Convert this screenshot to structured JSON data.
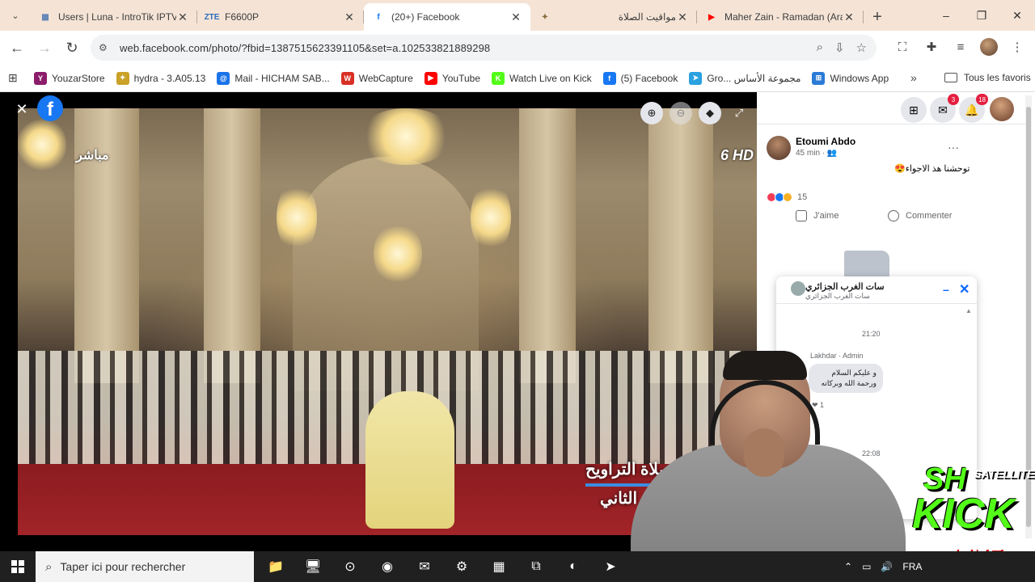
{
  "browser": {
    "tabs": [
      {
        "title": "Users | Luna - IntroTik IPTV",
        "icon_text": "▦",
        "icon_color": "#5a7fb5",
        "active": false,
        "rtl": false
      },
      {
        "title": "F6600P",
        "icon_text": "ZTE",
        "icon_color": "#2a6ebd",
        "active": false,
        "rtl": false
      },
      {
        "title": "(20+) Facebook",
        "icon_text": "f",
        "icon_color": "#1877f2",
        "active": true,
        "rtl": false
      },
      {
        "title": "مواقيت الصلاة",
        "icon_text": "✦",
        "icon_color": "#8a6d3b",
        "active": false,
        "rtl": true
      },
      {
        "title": "Maher Zain - Ramadan (Ara",
        "icon_text": "▶",
        "icon_color": "#ff0000",
        "active": false,
        "rtl": false
      }
    ],
    "new_tab": "+",
    "url": "web.facebook.com/photo/?fbid=1387515623391105&set=a.102533821889298",
    "bookmarks": [
      {
        "label": "YouzarStore",
        "icon_text": "Y",
        "icon_color": "#8b1d6b"
      },
      {
        "label": "hydra - 3.A05.13",
        "icon_text": "✦",
        "icon_color": "#c9a227"
      },
      {
        "label": "Mail - HICHAM SAB...",
        "icon_text": "@",
        "icon_color": "#1a73e8"
      },
      {
        "label": "WebCapture",
        "icon_text": "W",
        "icon_color": "#d93025"
      },
      {
        "label": "YouTube",
        "icon_text": "▶",
        "icon_color": "#ff0000"
      },
      {
        "label": "Watch Live on Kick",
        "icon_text": "K",
        "icon_color": "#53fc18"
      },
      {
        "label": "(5) Facebook",
        "icon_text": "f",
        "icon_color": "#1877f2"
      },
      {
        "label": "Gro... مجموعة الأساس",
        "icon_text": "➤",
        "icon_color": "#2aa1e0"
      },
      {
        "label": "Windows App",
        "icon_text": "⊞",
        "icon_color": "#2b7bd6"
      }
    ],
    "bookmarks_more": "»",
    "all_bookmarks": "Tous les favoris"
  },
  "viewer": {
    "live_text": "مباشر",
    "channel": "6 HD",
    "caption_line1": "صلاة التراويح",
    "caption_line2": "اليوم الثاني",
    "close": "✕",
    "facebook_logo": "f",
    "controls": [
      "zoom-in",
      "zoom-out",
      "tag",
      "fullscreen"
    ]
  },
  "sidebar": {
    "messenger_badge": "3",
    "notifications_badge": "18",
    "post": {
      "author": "Etoumi Abdo",
      "time": "45 min · 👥",
      "more": "···",
      "text": "توحشنا هذ الاجواء😍",
      "reaction_count": "15",
      "like_label": "J'aime",
      "comment_label": "Commenter"
    }
  },
  "chat": {
    "name": "سات الغرب الجزائري",
    "subtitle": "سات الغرب الجزائري",
    "minimize": "–",
    "close": "✕",
    "time1": "21:20",
    "sender": "Lakhdar · Admin",
    "message": "و عليكم السلام ورحمة الله وبركاته",
    "reaction": "❤ 1",
    "time2": "22:08"
  },
  "overlay": {
    "sh": "SH",
    "satellite": "SATELLITE",
    "kick": "KICK",
    "live": "LIVE"
  },
  "taskbar": {
    "search_placeholder": "Taper ici pour rechercher",
    "language": "FRA",
    "apps": [
      "📁",
      "🖥",
      "⊙",
      "◉",
      "✉",
      "⚙",
      "▦",
      "⧉",
      "◐",
      "➤"
    ]
  }
}
